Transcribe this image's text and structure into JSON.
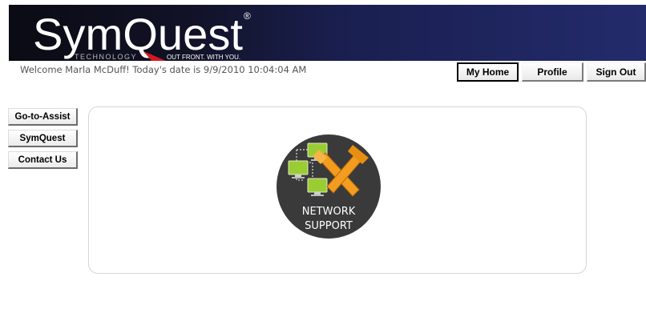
{
  "brand": {
    "logo_text": "SymQuest",
    "registered_mark": "®",
    "tagline_left": "TECHNOLOGY",
    "tagline_right": "OUT FRONT. WITH YOU."
  },
  "header": {
    "welcome_text": "Welcome Marla McDuff! Today's date is 9/9/2010 10:04:04 AM"
  },
  "top_nav": {
    "home_label": "My Home",
    "profile_label": "Profile",
    "signout_label": "Sign Out"
  },
  "side_nav": {
    "items": [
      {
        "label": "Go-to-Assist"
      },
      {
        "label": "SymQuest"
      },
      {
        "label": "Contact Us"
      }
    ]
  },
  "main": {
    "badge_line1": "NETWORK",
    "badge_line2": "SUPPORT"
  },
  "colors": {
    "banner_dark": "#0b0b14",
    "banner_blue": "#232b6c",
    "accent_red": "#d71920",
    "monitor_green": "#9acd32",
    "tools_orange": "#f39c1f"
  }
}
